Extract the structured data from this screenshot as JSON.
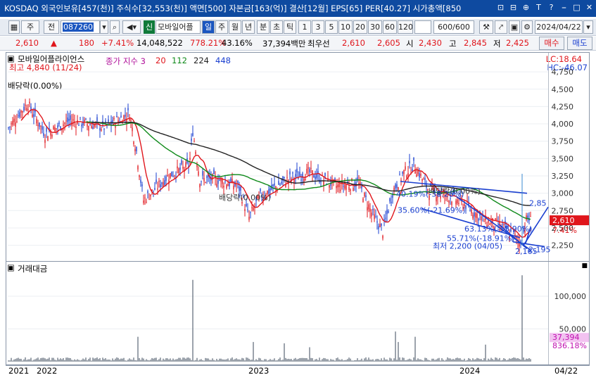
{
  "title": {
    "text": "KOSDAQ 외국인보유[457(천)] 주식수[32,553(천)] 액면[500] 자본금[163(억)] 결산[12월] EPS[65] PER[40.27] 시가총액[850",
    "buttons": [
      "⊡",
      "⊟",
      "⊕",
      "T",
      "?",
      "⎯",
      "□",
      "✕"
    ]
  },
  "toolbar": {
    "period_select": "주",
    "prev_btn": "전",
    "code": "087260",
    "stock_flag": "신",
    "stock_name": "모바일어플",
    "periods": [
      "일",
      "주",
      "월",
      "년",
      "분",
      "초",
      "틱"
    ],
    "active_period": "일",
    "minutes": [
      "1",
      "3",
      "5",
      "10",
      "20",
      "30",
      "60",
      "120"
    ],
    "count": "600/600",
    "date": "2024/04/22"
  },
  "quote": {
    "price": "2,610",
    "change_arrow": "▲",
    "change": "180",
    "change_pct": "+7.41%",
    "volume": "14,048,522",
    "vol_ratio": "778.21%",
    "turnover": "43.16%",
    "amount": "37,394백만",
    "best_ask_label": "최우선",
    "best_ask": "2,610",
    "best_bid": "2,605",
    "open_label": "시",
    "open": "2,430",
    "high_label": "고",
    "high": "2,845",
    "low_label": "저",
    "low": "2,425",
    "buy_btn": "매수",
    "sell_btn": "매도"
  },
  "price_panel": {
    "stock": "모바일어플라이언스",
    "ma_label": "종가 지수 3",
    "ma_periods": [
      "20",
      "112",
      "224",
      "448"
    ],
    "ma_colors": [
      "#e0161c",
      "#0f8a1a",
      "#222222",
      "#1a3fd0"
    ],
    "high_note": "최고 4,840 (11/24)",
    "div_note": "배당락(0.00%)",
    "div_note2": "배당락(0.00%)",
    "div_note3": "배당락(0.00%)",
    "lc": "LC:18.64",
    "hc": "HC:-46.07",
    "y_ticks": [
      "4,750",
      "4,500",
      "4,250",
      "4,000",
      "3,750",
      "3,500",
      "3,250",
      "3,000",
      "2,750",
      "2,500",
      "2,250"
    ],
    "price_tag": "2,610",
    "pct_tag": "7.41%",
    "notes": {
      "n1": "40.19%(-38.26%)",
      "n2": "35.60%(-21.69%)",
      "n3": "63.13%(-15.90%)",
      "n4": "55.71%(-18.91%)",
      "low": "최저 2,200 (04/05)",
      "p1": "2,85",
      "p2": "2,165",
      "p3": "2,195"
    },
    "up_color": "#e0161c",
    "down_color": "#1a3fd0"
  },
  "volume_panel": {
    "label": "거래대금",
    "y_ticks": [
      "100,000",
      "50,000"
    ],
    "value_tag": "37,394",
    "pct_tag": "836.18%"
  },
  "x_axis": {
    "labels": [
      "2021",
      "2022",
      "2023",
      "2024",
      "04/22"
    ]
  }
}
